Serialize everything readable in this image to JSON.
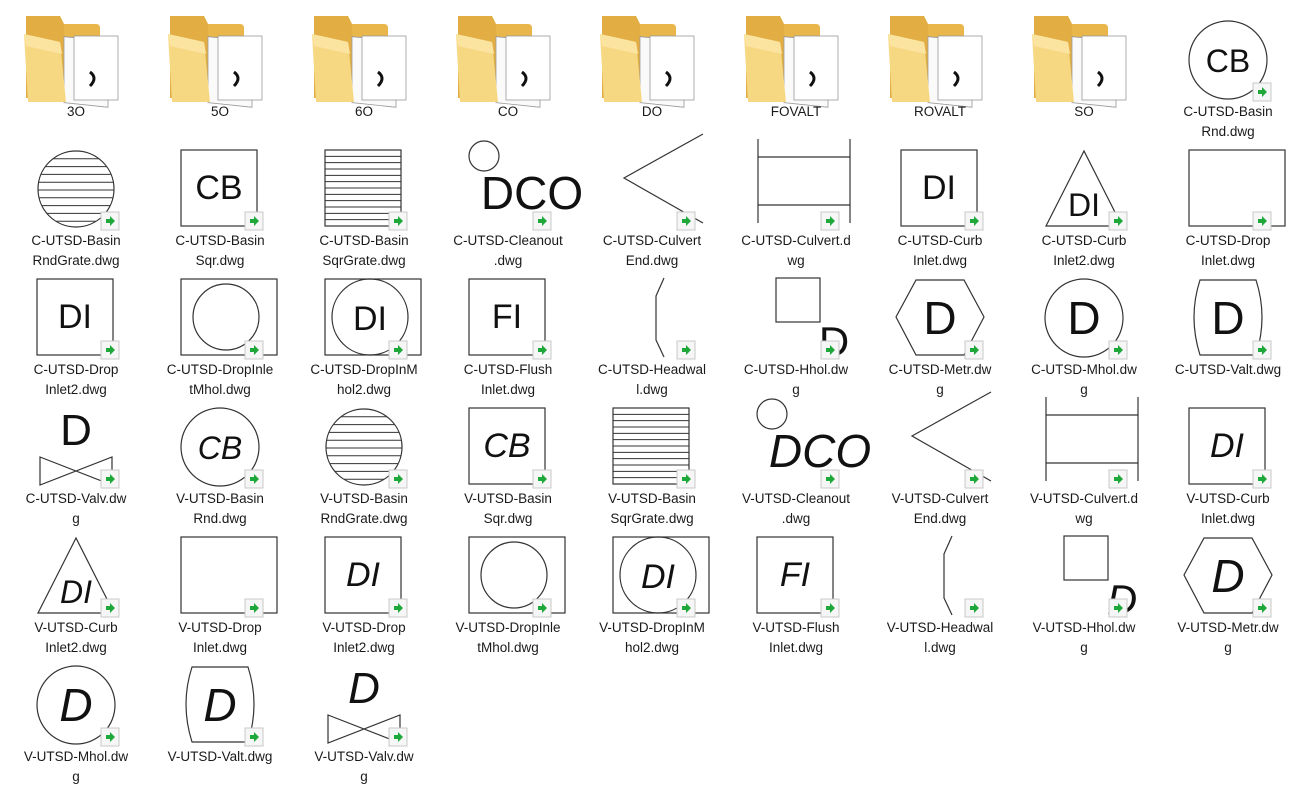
{
  "items": [
    {
      "kind": "folder",
      "label": "3O"
    },
    {
      "kind": "folder",
      "label": "5O"
    },
    {
      "kind": "folder",
      "label": "6O"
    },
    {
      "kind": "folder",
      "label": "CO"
    },
    {
      "kind": "folder",
      "label": "DO"
    },
    {
      "kind": "folder",
      "label": "FOVALT"
    },
    {
      "kind": "folder",
      "label": "ROVALT"
    },
    {
      "kind": "folder",
      "label": "SO"
    },
    {
      "kind": "dwg",
      "symbol": "circle-text",
      "text": "CB",
      "italic": false,
      "label": "C-UTSD-Basin\nRnd.dwg"
    },
    {
      "kind": "dwg",
      "symbol": "circle-grate",
      "label": "C-UTSD-Basin\nRndGrate.dwg"
    },
    {
      "kind": "dwg",
      "symbol": "square-text",
      "text": "CB",
      "italic": false,
      "label": "C-UTSD-Basin\nSqr.dwg"
    },
    {
      "kind": "dwg",
      "symbol": "square-grate",
      "label": "C-UTSD-Basin\nSqrGrate.dwg"
    },
    {
      "kind": "dwg",
      "symbol": "cleanout",
      "text": "DCO",
      "italic": false,
      "label": "C-UTSD-Cleanout\n.dwg"
    },
    {
      "kind": "dwg",
      "symbol": "culvert-end",
      "label": "C-UTSD-Culvert\nEnd.dwg"
    },
    {
      "kind": "dwg",
      "symbol": "culvert",
      "label": "C-UTSD-Culvert.d\nwg"
    },
    {
      "kind": "dwg",
      "symbol": "square-text",
      "text": "DI",
      "italic": false,
      "label": "C-UTSD-Curb\nInlet.dwg"
    },
    {
      "kind": "dwg",
      "symbol": "triangle-text",
      "text": "DI",
      "italic": false,
      "label": "C-UTSD-Curb\nInlet2.dwg"
    },
    {
      "kind": "dwg",
      "symbol": "square-empty",
      "label": "C-UTSD-Drop\nInlet.dwg"
    },
    {
      "kind": "dwg",
      "symbol": "square-text",
      "text": "DI",
      "italic": false,
      "label": "C-UTSD-Drop\nInlet2.dwg"
    },
    {
      "kind": "dwg",
      "symbol": "square-circle",
      "label": "C-UTSD-DropInle\ntMhol.dwg"
    },
    {
      "kind": "dwg",
      "symbol": "square-circle-text",
      "text": "DI",
      "italic": false,
      "label": "C-UTSD-DropInM\nhol2.dwg"
    },
    {
      "kind": "dwg",
      "symbol": "square-text",
      "text": "FI",
      "italic": false,
      "label": "C-UTSD-Flush\nInlet.dwg"
    },
    {
      "kind": "dwg",
      "symbol": "headwall",
      "label": "C-UTSD-Headwal\nl.dwg"
    },
    {
      "kind": "dwg",
      "symbol": "hhol",
      "text": "D",
      "italic": false,
      "label": "C-UTSD-Hhol.dw\ng"
    },
    {
      "kind": "dwg",
      "symbol": "hexagon-text",
      "text": "D",
      "italic": false,
      "label": "C-UTSD-Metr.dw\ng"
    },
    {
      "kind": "dwg",
      "symbol": "circle-text",
      "text": "D",
      "italic": false,
      "label": "C-UTSD-Mhol.dw\ng"
    },
    {
      "kind": "dwg",
      "symbol": "valt",
      "text": "D",
      "italic": false,
      "label": "C-UTSD-Valt.dwg"
    },
    {
      "kind": "dwg",
      "symbol": "valve",
      "text": "D",
      "italic": false,
      "label": "C-UTSD-Valv.dw\ng"
    },
    {
      "kind": "dwg",
      "symbol": "circle-text",
      "text": "CB",
      "italic": true,
      "label": "V-UTSD-Basin\nRnd.dwg"
    },
    {
      "kind": "dwg",
      "symbol": "circle-grate",
      "label": "V-UTSD-Basin\nRndGrate.dwg"
    },
    {
      "kind": "dwg",
      "symbol": "square-text",
      "text": "CB",
      "italic": true,
      "label": "V-UTSD-Basin\nSqr.dwg"
    },
    {
      "kind": "dwg",
      "symbol": "square-grate",
      "label": "V-UTSD-Basin\nSqrGrate.dwg"
    },
    {
      "kind": "dwg",
      "symbol": "cleanout",
      "text": "DCO",
      "italic": true,
      "label": "V-UTSD-Cleanout\n.dwg"
    },
    {
      "kind": "dwg",
      "symbol": "culvert-end",
      "label": "V-UTSD-Culvert\nEnd.dwg"
    },
    {
      "kind": "dwg",
      "symbol": "culvert",
      "label": "V-UTSD-Culvert.d\nwg"
    },
    {
      "kind": "dwg",
      "symbol": "square-text",
      "text": "DI",
      "italic": true,
      "label": "V-UTSD-Curb\nInlet.dwg"
    },
    {
      "kind": "dwg",
      "symbol": "triangle-text",
      "text": "DI",
      "italic": true,
      "label": "V-UTSD-Curb\nInlet2.dwg"
    },
    {
      "kind": "dwg",
      "symbol": "square-empty",
      "label": "V-UTSD-Drop\nInlet.dwg"
    },
    {
      "kind": "dwg",
      "symbol": "square-text",
      "text": "DI",
      "italic": true,
      "label": "V-UTSD-Drop\nInlet2.dwg"
    },
    {
      "kind": "dwg",
      "symbol": "square-circle",
      "label": "V-UTSD-DropInle\ntMhol.dwg"
    },
    {
      "kind": "dwg",
      "symbol": "square-circle-text",
      "text": "DI",
      "italic": true,
      "label": "V-UTSD-DropInM\nhol2.dwg"
    },
    {
      "kind": "dwg",
      "symbol": "square-text",
      "text": "FI",
      "italic": true,
      "label": "V-UTSD-Flush\nInlet.dwg"
    },
    {
      "kind": "dwg",
      "symbol": "headwall",
      "label": "V-UTSD-Headwal\nl.dwg"
    },
    {
      "kind": "dwg",
      "symbol": "hhol",
      "text": "D",
      "italic": true,
      "label": "V-UTSD-Hhol.dw\ng"
    },
    {
      "kind": "dwg",
      "symbol": "hexagon-text",
      "text": "D",
      "italic": true,
      "label": "V-UTSD-Metr.dw\ng"
    },
    {
      "kind": "dwg",
      "symbol": "circle-text",
      "text": "D",
      "italic": true,
      "label": "V-UTSD-Mhol.dw\ng"
    },
    {
      "kind": "dwg",
      "symbol": "valt",
      "text": "D",
      "italic": true,
      "label": "V-UTSD-Valt.dwg"
    },
    {
      "kind": "dwg",
      "symbol": "valve",
      "text": "D",
      "italic": true,
      "label": "V-UTSD-Valv.dw\ng"
    }
  ],
  "colors": {
    "folder_back": "#e8b64a",
    "folder_front": "#f7d882",
    "badge_green": "#1fa83a",
    "stroke": "#333333",
    "text": "#111111"
  },
  "icons": {
    "folder": "folder-icon",
    "shortcut": "shortcut-arrow-icon"
  }
}
